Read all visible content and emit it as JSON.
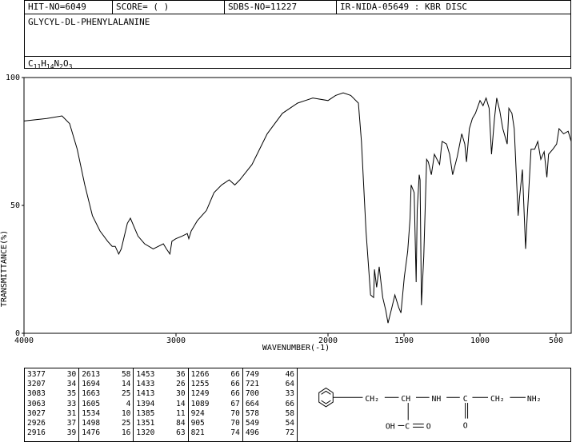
{
  "header": {
    "hit_no": "HIT-NO=6049",
    "score": "SCORE=  (   )",
    "sdbs_no": "SDBS-NO=11227",
    "ir_info": "IR-NIDA-05649 : KBR DISC",
    "compound_name": "GLYCYL-DL-PHENYLALANINE",
    "formula": {
      "C": "11",
      "H": "14",
      "N": "2",
      "O": "3"
    }
  },
  "chart_data": {
    "type": "line",
    "xlabel": "WAVENUMBER(-1)",
    "ylabel": "TRANSMITTANCE(%)",
    "xlim": [
      4000,
      400
    ],
    "ylim": [
      0,
      100
    ],
    "xticks": [
      4000,
      3000,
      2000,
      1500,
      1000,
      500
    ],
    "yticks": [
      0,
      50,
      100
    ],
    "series": [
      {
        "x": [
          4000,
          3850,
          3750,
          3700,
          3650,
          3600,
          3550,
          3500,
          3450,
          3420,
          3400,
          3377,
          3360,
          3320,
          3300,
          3250,
          3207,
          3150,
          3083,
          3063,
          3040,
          3027,
          3000,
          2960,
          2926,
          2916,
          2900,
          2880,
          2860,
          2800,
          2750,
          2700,
          2650,
          2613,
          2580,
          2500,
          2450,
          2400,
          2300,
          2200,
          2100,
          2000,
          1950,
          1900,
          1850,
          1800,
          1780,
          1750,
          1720,
          1700,
          1694,
          1680,
          1663,
          1640,
          1620,
          1605,
          1580,
          1560,
          1534,
          1520,
          1498,
          1476,
          1460,
          1453,
          1433,
          1420,
          1413,
          1400,
          1394,
          1385,
          1370,
          1351,
          1340,
          1320,
          1300,
          1266,
          1255,
          1249,
          1220,
          1200,
          1180,
          1150,
          1120,
          1100,
          1089,
          1070,
          1050,
          1030,
          1000,
          980,
          960,
          940,
          924,
          920,
          905,
          890,
          870,
          850,
          821,
          810,
          790,
          775,
          749,
          740,
          721,
          700,
          690,
          680,
          664,
          640,
          620,
          600,
          578,
          560,
          549,
          520,
          496,
          480,
          450,
          420,
          400
        ],
        "y": [
          83,
          84,
          85,
          82,
          72,
          58,
          46,
          40,
          36,
          34,
          34,
          31,
          33,
          43,
          45,
          38,
          35,
          33,
          35,
          33,
          31,
          36,
          37,
          38,
          39,
          37,
          40,
          42,
          44,
          48,
          55,
          58,
          60,
          58,
          60,
          66,
          72,
          78,
          86,
          90,
          92,
          91,
          93,
          94,
          93,
          90,
          75,
          40,
          15,
          14,
          25,
          18,
          26,
          14,
          9,
          4,
          10,
          15,
          10,
          8,
          22,
          32,
          45,
          58,
          55,
          20,
          48,
          62,
          60,
          11,
          30,
          68,
          67,
          62,
          70,
          66,
          72,
          75,
          74,
          70,
          62,
          69,
          78,
          74,
          67,
          80,
          84,
          86,
          91,
          89,
          92,
          88,
          70,
          73,
          84,
          92,
          87,
          80,
          74,
          88,
          86,
          80,
          46,
          53,
          64,
          33,
          45,
          55,
          72,
          72,
          75,
          68,
          71,
          61,
          70,
          72,
          74,
          80,
          78,
          79,
          75
        ]
      }
    ]
  },
  "peaks": [
    [
      [
        "3377",
        "30"
      ],
      [
        "3207",
        "34"
      ],
      [
        "3083",
        "35"
      ],
      [
        "3063",
        "33"
      ],
      [
        "3027",
        "31"
      ],
      [
        "2926",
        "37"
      ],
      [
        "2916",
        "39"
      ]
    ],
    [
      [
        "2613",
        "58"
      ],
      [
        "1694",
        "14"
      ],
      [
        "1663",
        "25"
      ],
      [
        "1605",
        "4"
      ],
      [
        "1534",
        "10"
      ],
      [
        "1498",
        "25"
      ],
      [
        "1476",
        "16"
      ]
    ],
    [
      [
        "1453",
        "36"
      ],
      [
        "1433",
        "26"
      ],
      [
        "1413",
        "30"
      ],
      [
        "1394",
        "14"
      ],
      [
        "1385",
        "11"
      ],
      [
        "1351",
        "84"
      ],
      [
        "1320",
        "63"
      ]
    ],
    [
      [
        "1266",
        "66"
      ],
      [
        "1255",
        "66"
      ],
      [
        "1249",
        "66"
      ],
      [
        "1089",
        "67"
      ],
      [
        "924",
        "70"
      ],
      [
        "905",
        "70"
      ],
      [
        "821",
        "74"
      ]
    ],
    [
      [
        "749",
        "46"
      ],
      [
        "721",
        "64"
      ],
      [
        "700",
        "33"
      ],
      [
        "664",
        "66"
      ],
      [
        "578",
        "58"
      ],
      [
        "549",
        "54"
      ],
      [
        "496",
        "72"
      ]
    ]
  ],
  "structure": {
    "ch2_a": "CH₂",
    "ch": "CH",
    "nh": "NH",
    "c": "C",
    "ch2_b": "CH₂",
    "nh2": "NH₂",
    "o": "O",
    "oh": "OH",
    "c_acid": "C",
    "o_acid": "O"
  }
}
